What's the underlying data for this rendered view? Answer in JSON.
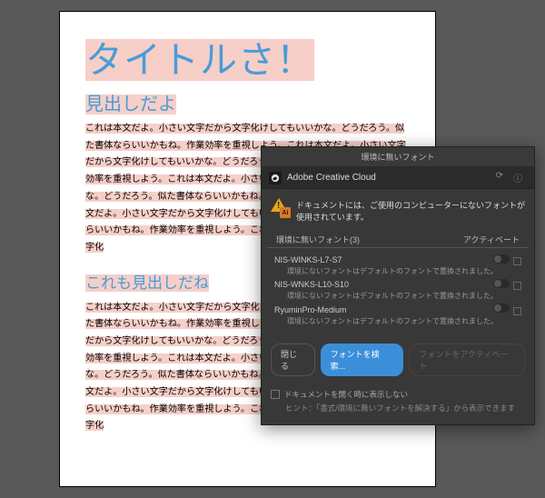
{
  "document": {
    "title": "タイトルさ！",
    "heading1": "見出しだよ",
    "body1": "これは本文だよ。小さい文字だから文字化けしてもいいかな。どうだろう。似た書体ならいいかもね。作業効率を重視しよう。これは本文だよ。小さい文字だから文字化けしてもいいかな。どうだろう。似た書体ならいいかもね。作業効率を重視しよう。これは本文だよ。小さい文字だから文字化けしてもいいかな。どうだろう。似た書体ならいいかもね。作業効率を重視しよう。これは本文だよ。小さい文字だから文字化けしてもいいかな。どうだろう。似た書体ならいいかもね。作業効率を重視しよう。これは本文だよ。小さい文字だから文字化",
    "heading2": "これも見出しだね",
    "body2": "これは本文だよ。小さい文字だから文字化けしてもいいかな。どうだろう。似た書体ならいいかもね。作業効率を重視しよう。これは本文だよ。小さい文字だから文字化けしてもいいかな。どうだろう。似た書体ならいいかもね。作業効率を重視しよう。これは本文だよ。小さい文字だから文字化けしてもいいかな。どうだろう。似た書体ならいいかもね。作業効率を重視しよう。これは本文だよ。小さい文字だから文字化けしてもいいかな。どうだろう。似た書体ならいいかもね。作業効率を重視しよう。これは本文だよ。小さい文字だから文字化"
  },
  "dialog": {
    "window_title": "環境に無いフォント",
    "app_name": "Adobe Creative Cloud",
    "ai_badge": "Ai",
    "message": "ドキュメントには、ご使用のコンピューターにないフォントが使用されています。",
    "list_header_left": "環境に無いフォント(3)",
    "list_header_right": "アクティベート",
    "fonts": [
      {
        "name": "NIS-WINKS-L7-S7",
        "status": "環境にないフォントはデフォルトのフォントで置換されました。"
      },
      {
        "name": "NIS-WNKS-L10-S10",
        "status": "環境にないフォントはデフォルトのフォントで置換されました。"
      },
      {
        "name": "RyuminPro-Medium",
        "status": "環境にないフォントはデフォルトのフォントで置換されました。"
      }
    ],
    "btn_close": "閉じる",
    "btn_search": "フォントを検索...",
    "btn_activate": "フォントをアクティベート",
    "checkbox_label": "ドキュメントを開く時に表示しない",
    "hint": "ヒント：「書式/環境に無いフォントを解決する」から表示できます"
  }
}
